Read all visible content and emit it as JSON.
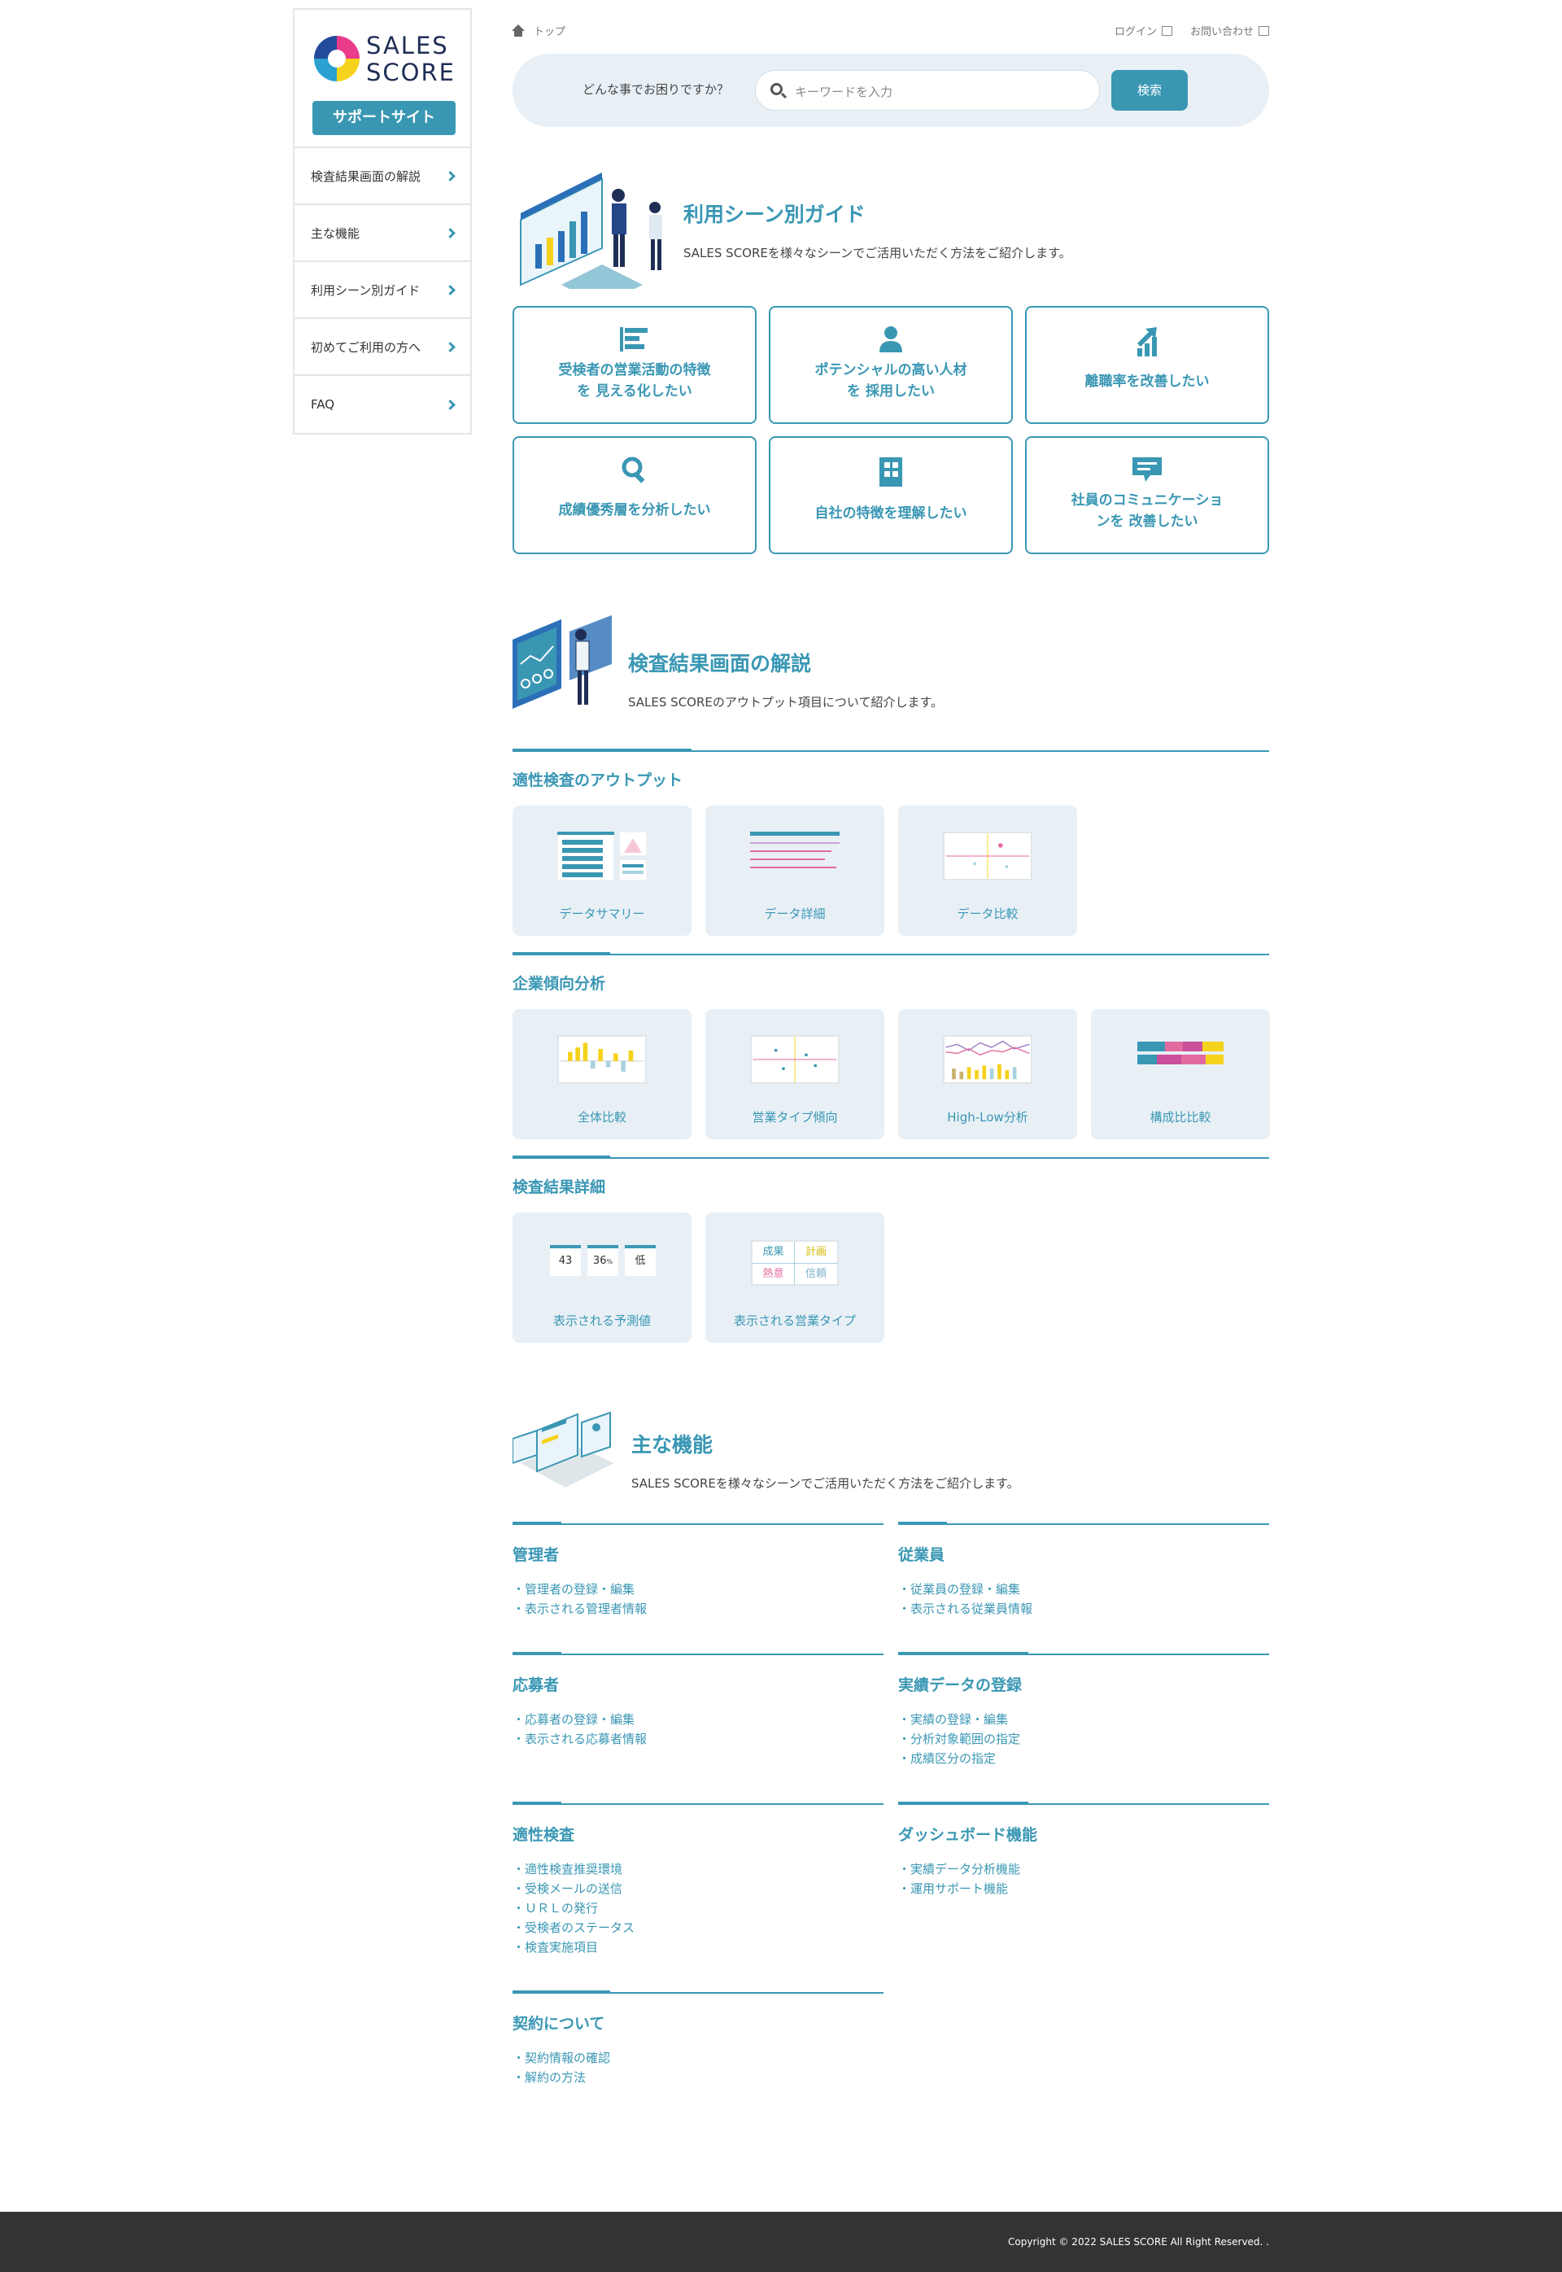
{
  "sidebar": {
    "logo_line1": "SALES",
    "logo_line2": "SCORE",
    "support_label": "サポートサイト",
    "items": [
      {
        "label": "検査結果画面の解説"
      },
      {
        "label": "主な機能"
      },
      {
        "label": "利用シーン別ガイド"
      },
      {
        "label": "初めてご利用の方へ"
      },
      {
        "label": "FAQ"
      }
    ]
  },
  "header": {
    "breadcrumb": "トップ",
    "login": "ログイン",
    "contact": "お問い合わせ"
  },
  "search": {
    "question": "どんな事でお困りですか？",
    "placeholder": "キーワードを入力",
    "button": "検索"
  },
  "scene": {
    "title": "利用シーン別ガイド",
    "desc": "SALES SCOREを様々なシーンでご活用いただく方法をご紹介します。",
    "cards": [
      {
        "line1": "受検者の営業活動の特徴",
        "line2": "を 見える化したい",
        "icon": "bar-chart-icon"
      },
      {
        "line1": "ポテンシャルの高い人材",
        "line2": "を 採用したい",
        "icon": "person-icon"
      },
      {
        "line1": "離職率を改善したい",
        "line2": "",
        "icon": "growth-arrow-icon"
      },
      {
        "line1": "成績優秀層を分析したい",
        "line2": "",
        "icon": "search-icon"
      },
      {
        "line1": "自社の特徴を理解したい",
        "line2": "",
        "icon": "building-icon"
      },
      {
        "line1": "社員のコミュニケーショ",
        "line2": "ンを 改善したい",
        "icon": "chat-icon"
      }
    ]
  },
  "results": {
    "title": "検査結果画面の解説",
    "desc": "SALES SCOREのアウトプット項目について紹介します。",
    "groups": [
      {
        "title": "適性検査のアウトプット",
        "items": [
          "データサマリー",
          "データ詳細",
          "データ比較"
        ]
      },
      {
        "title": "企業傾向分析",
        "items": [
          "全体比較",
          "営業タイプ傾向",
          "High-Low分析",
          "構成比比較"
        ]
      },
      {
        "title": "検査結果詳細",
        "items": [
          "表示される予測値",
          "表示される営業タイプ"
        ]
      }
    ],
    "predict_values": [
      "43",
      "36",
      "低"
    ],
    "predict_unit": "%",
    "type_labels": [
      "成果",
      "計画",
      "熱意",
      "信頼"
    ]
  },
  "features": {
    "title": "主な機能",
    "desc": "SALES SCOREを様々なシーンでご活用いただく方法をご紹介します。",
    "blocks": [
      {
        "title": "管理者",
        "links": [
          "管理者の登録・編集",
          "表示される管理者情報"
        ]
      },
      {
        "title": "従業員",
        "links": [
          "従業員の登録・編集",
          "表示される従業員情報"
        ]
      },
      {
        "title": "応募者",
        "links": [
          "応募者の登録・編集",
          "表示される応募者情報"
        ]
      },
      {
        "title": "実績データの登録",
        "links": [
          "実績の登録・編集",
          "分析対象範囲の指定",
          "成績区分の指定"
        ]
      },
      {
        "title": "適性検査",
        "links": [
          "適性検査推奨環境",
          "受検メールの送信",
          "ＵＲＬの発行",
          "受検者のステータス",
          "検査実施項目"
        ]
      },
      {
        "title": "ダッシュボード機能",
        "links": [
          "実績データ分析機能",
          "運用サポート機能"
        ]
      },
      {
        "title": "契約について",
        "links": [
          "契約情報の確認",
          "解約の方法"
        ]
      }
    ]
  },
  "footer": {
    "copyright": "Copyright © 2022 SALES SCORE All Right Reserved. ."
  },
  "colors": {
    "accent": "#3a97b4",
    "panel": "#e8f0f6",
    "footer": "#333333"
  }
}
